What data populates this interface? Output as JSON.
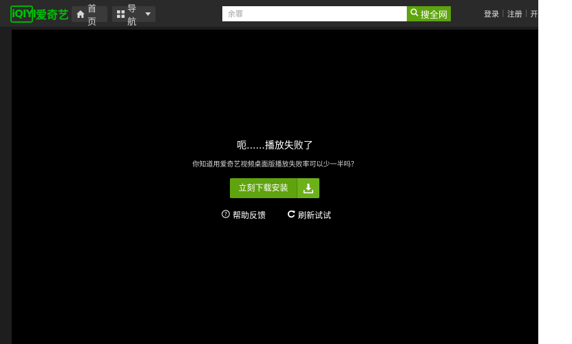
{
  "header": {
    "logo_mark": "iQIYI",
    "logo_text": "爱奇艺",
    "home_label": "首页",
    "guide_label": "导航",
    "search": {
      "placeholder": "余罪"
    },
    "search_button_label": "搜全网",
    "links": [
      "登录",
      "注册",
      "开通"
    ],
    "separator": "|"
  },
  "player": {
    "error_title": "呃......播放失败了",
    "error_subtitle": "你知道用爱奇艺视频桌面版播放失败率可以少一半吗？",
    "download_button_label": "立刻下载安装",
    "help_label": "帮助反馈",
    "retry_label": "刷新试试"
  },
  "colors": {
    "brand_green": "#00be06",
    "button_green": "#5fa30e",
    "header_bg": "#2a2a2a",
    "player_bg": "#000000"
  },
  "icons": [
    "home-icon",
    "grid-icon",
    "caret-down-icon",
    "search-icon",
    "download-icon",
    "help-icon",
    "refresh-icon"
  ]
}
